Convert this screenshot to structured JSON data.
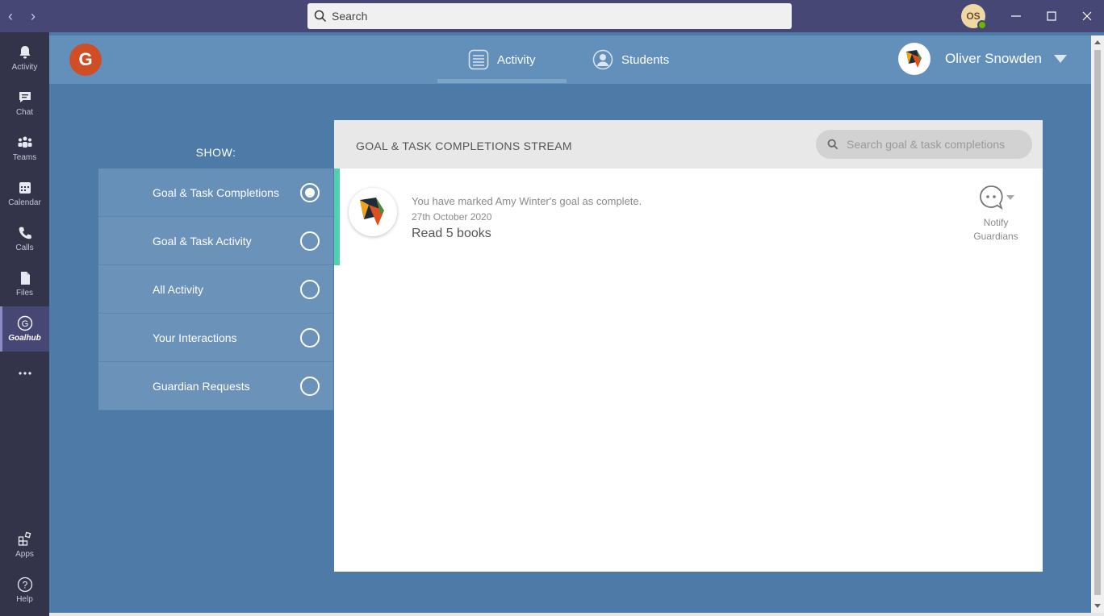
{
  "titlebar": {
    "search_placeholder": "Search",
    "user_initials": "OS"
  },
  "rail": {
    "items": [
      {
        "label": "Activity",
        "icon": "bell-icon"
      },
      {
        "label": "Chat",
        "icon": "chat-icon"
      },
      {
        "label": "Teams",
        "icon": "teams-icon"
      },
      {
        "label": "Calendar",
        "icon": "calendar-icon"
      },
      {
        "label": "Calls",
        "icon": "phone-icon"
      },
      {
        "label": "Files",
        "icon": "file-icon"
      },
      {
        "label": "Goalhub",
        "icon": "goalhub-icon"
      },
      {
        "label": "Apps",
        "icon": "apps-icon"
      },
      {
        "label": "Help",
        "icon": "help-icon"
      }
    ]
  },
  "header": {
    "logo_letter": "G",
    "tabs": [
      {
        "label": "Activity",
        "active": true
      },
      {
        "label": "Students",
        "active": false
      }
    ],
    "user_name": "Oliver Snowden"
  },
  "filters": {
    "show_label": "SHOW:",
    "items": [
      {
        "label": "Goal & Task Completions",
        "selected": true
      },
      {
        "label": "Goal & Task Activity",
        "selected": false
      },
      {
        "label": "All Activity",
        "selected": false
      },
      {
        "label": "Your Interactions",
        "selected": false
      },
      {
        "label": "Guardian Requests",
        "selected": false
      }
    ]
  },
  "stream": {
    "title": "GOAL & TASK COMPLETIONS STREAM",
    "search_placeholder": "Search goal & task completions",
    "entries": [
      {
        "description": "You have marked Amy Winter's goal as complete.",
        "date": "27th October 2020",
        "goal": "Read 5 books",
        "notify_line1": "Notify",
        "notify_line2": "Guardians"
      }
    ]
  },
  "colors": {
    "rail_bg": "#33344a",
    "titlebar_bg": "#464775",
    "app_bg": "#4e7aa8",
    "header_bg": "#6390ba",
    "logo_bg": "#d04e26",
    "accent_green": "#4fd1b0"
  }
}
